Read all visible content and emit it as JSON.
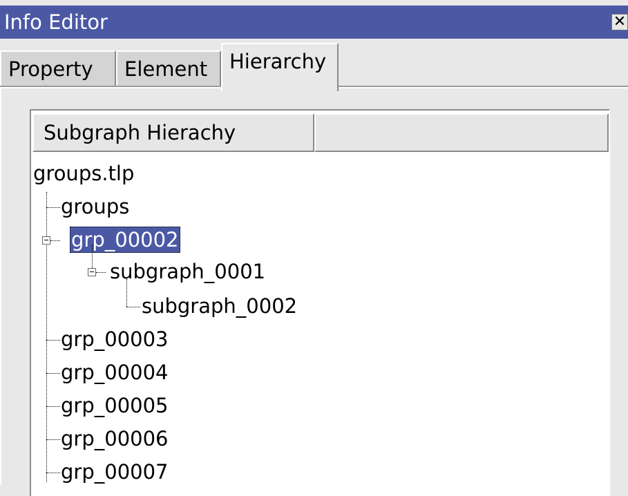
{
  "window": {
    "title": "Info Editor",
    "close_symbol": "✕"
  },
  "tabs": [
    {
      "label": "Property",
      "active": false
    },
    {
      "label": "Element",
      "active": false
    },
    {
      "label": "Hierarchy",
      "active": true
    }
  ],
  "tree": {
    "columns": [
      "Subgraph Hierachy",
      ""
    ],
    "root": "groups.tlp",
    "nodes": [
      {
        "label": "groups",
        "level": 1,
        "expandable": false
      },
      {
        "label": "grp_00002",
        "level": 1,
        "expandable": true,
        "expanded": true,
        "selected": true
      },
      {
        "label": "subgraph_0001",
        "level": 2,
        "expandable": true,
        "expanded": true
      },
      {
        "label": "subgraph_0002",
        "level": 3,
        "expandable": false
      },
      {
        "label": "grp_00003",
        "level": 1,
        "expandable": false
      },
      {
        "label": "grp_00004",
        "level": 1,
        "expandable": false
      },
      {
        "label": "grp_00005",
        "level": 1,
        "expandable": false
      },
      {
        "label": "grp_00006",
        "level": 1,
        "expandable": false
      },
      {
        "label": "grp_00007",
        "level": 1,
        "expandable": false
      }
    ]
  },
  "colors": {
    "titlebar": "#4b59a5",
    "selection": "#4b59a5",
    "background": "#e8e8e8"
  }
}
